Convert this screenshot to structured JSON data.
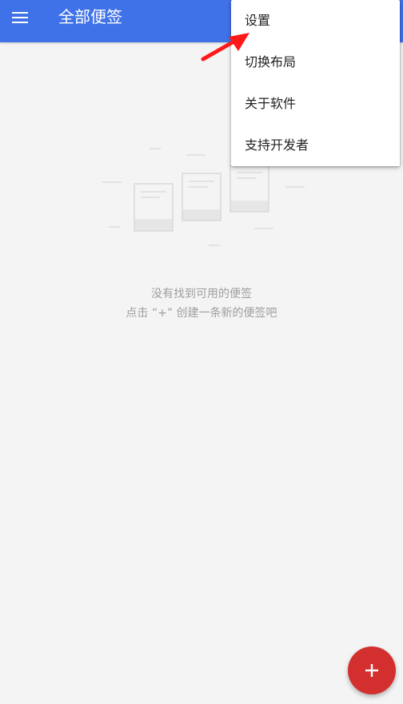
{
  "app_bar": {
    "title": "全部便签",
    "menu_icon": "hamburger-menu-icon",
    "background": "#3f72e8"
  },
  "empty_state": {
    "illustration": "empty-notes-icon",
    "title": "没有找到可用的便签",
    "hint": "点击 “+” 创建一条新的便签吧"
  },
  "overflow_menu": {
    "items": [
      {
        "label": "设置"
      },
      {
        "label": "切换布局"
      },
      {
        "label": "关于软件"
      },
      {
        "label": "支持开发者"
      }
    ]
  },
  "annotation": {
    "icon": "red-arrow-icon",
    "color": "#ff1a1a"
  },
  "fab": {
    "icon": "plus-icon",
    "color": "#d32f2f"
  }
}
